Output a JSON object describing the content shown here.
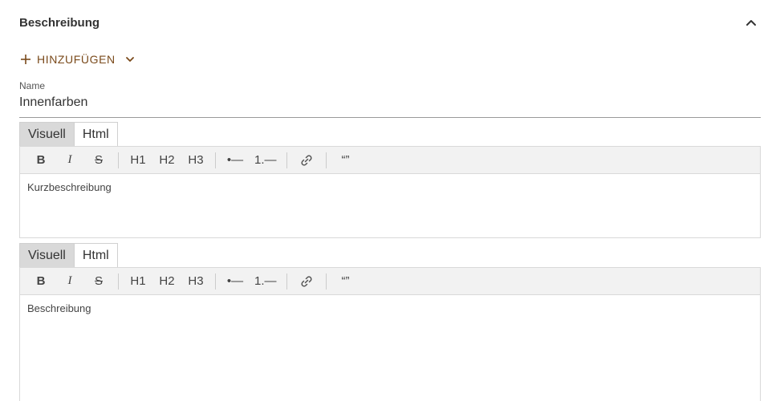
{
  "section": {
    "title": "Beschreibung",
    "collapse_icon": "chevron-up-icon"
  },
  "add_button": {
    "label": "HINZUFÜGEN",
    "icon": "plus-icon",
    "dropdown_icon": "chevron-down-icon",
    "color": "#7a4a1b"
  },
  "name_field": {
    "label": "Name",
    "value": "Innenfarben"
  },
  "editors": [
    {
      "tabs": [
        {
          "label": "Visuell",
          "active": true
        },
        {
          "label": "Html",
          "active": false
        }
      ],
      "toolbar": {
        "bold": "B",
        "italic": "I",
        "strike": "S",
        "h1": "H1",
        "h2": "H2",
        "h3": "H3",
        "bullet_list": "•—",
        "ordered_list": "1.—",
        "link_icon": "link-icon",
        "quote": "“”"
      },
      "content": "Kurzbeschreibung"
    },
    {
      "tabs": [
        {
          "label": "Visuell",
          "active": true
        },
        {
          "label": "Html",
          "active": false
        }
      ],
      "toolbar": {
        "bold": "B",
        "italic": "I",
        "strike": "S",
        "h1": "H1",
        "h2": "H2",
        "h3": "H3",
        "bullet_list": "•—",
        "ordered_list": "1.—",
        "link_icon": "link-icon",
        "quote": "“”"
      },
      "content": "Beschreibung"
    }
  ]
}
